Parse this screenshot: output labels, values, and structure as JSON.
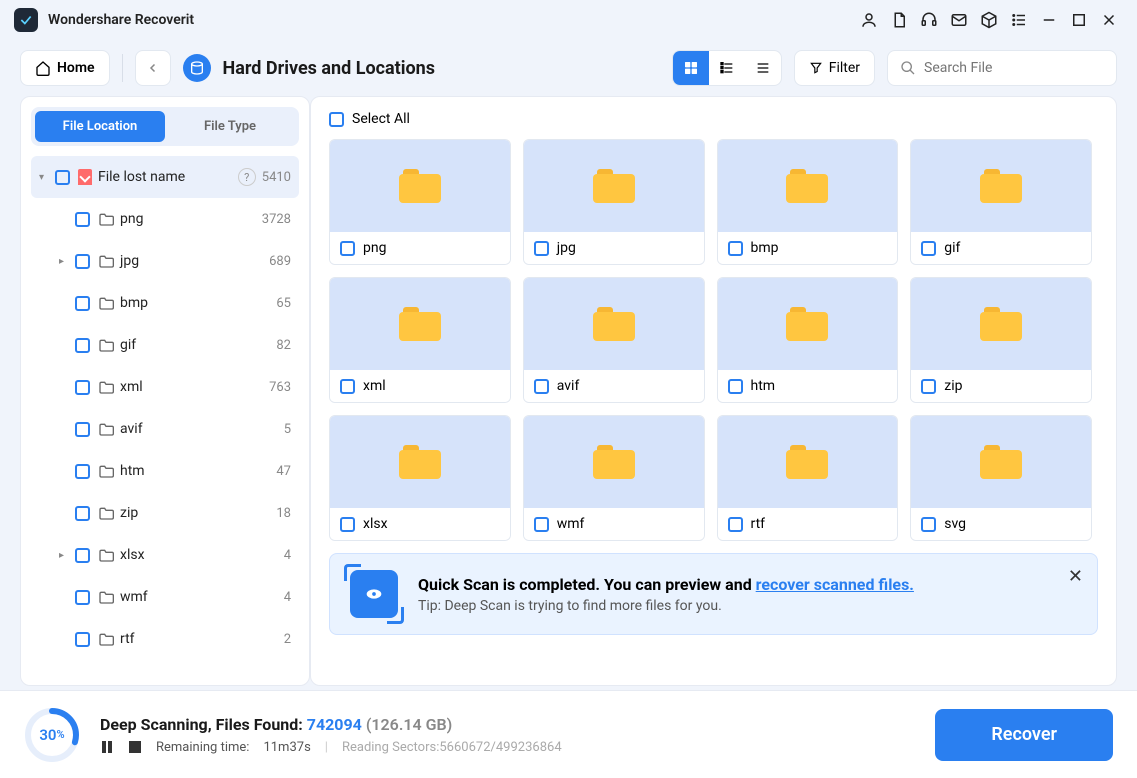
{
  "app": {
    "title": "Wondershare Recoverit"
  },
  "toolbar": {
    "home": "Home",
    "breadcrumb": "Hard Drives and Locations",
    "filter": "Filter",
    "search_placeholder": "Search File"
  },
  "sidebar": {
    "tabs": {
      "location": "File Location",
      "type": "File Type"
    },
    "root": {
      "label": "File lost name",
      "count": "5410"
    },
    "items": [
      {
        "name": "png",
        "count": "3728",
        "expandable": false
      },
      {
        "name": "jpg",
        "count": "689",
        "expandable": true
      },
      {
        "name": "bmp",
        "count": "65",
        "expandable": false
      },
      {
        "name": "gif",
        "count": "82",
        "expandable": false
      },
      {
        "name": "xml",
        "count": "763",
        "expandable": false
      },
      {
        "name": "avif",
        "count": "5",
        "expandable": false
      },
      {
        "name": "htm",
        "count": "47",
        "expandable": false
      },
      {
        "name": "zip",
        "count": "18",
        "expandable": false
      },
      {
        "name": "xlsx",
        "count": "4",
        "expandable": true
      },
      {
        "name": "wmf",
        "count": "4",
        "expandable": false
      },
      {
        "name": "rtf",
        "count": "2",
        "expandable": false
      }
    ]
  },
  "content": {
    "select_all": "Select All",
    "cards": [
      "png",
      "jpg",
      "bmp",
      "gif",
      "xml",
      "avif",
      "htm",
      "zip",
      "xlsx",
      "wmf",
      "rtf",
      "svg"
    ]
  },
  "notif": {
    "title_prefix": "Quick Scan is completed. You can preview and ",
    "title_link": "recover scanned files.",
    "tip": "Tip: Deep Scan is trying to find more files for you."
  },
  "footer": {
    "percent": "30",
    "scan_label": "Deep Scanning, Files Found: ",
    "scan_count": "742094",
    "scan_size": "(126.14 GB)",
    "remaining_label": "Remaining time:",
    "remaining_value": "11m37s",
    "sectors": "Reading Sectors:5660672/499236864",
    "recover": "Recover"
  }
}
